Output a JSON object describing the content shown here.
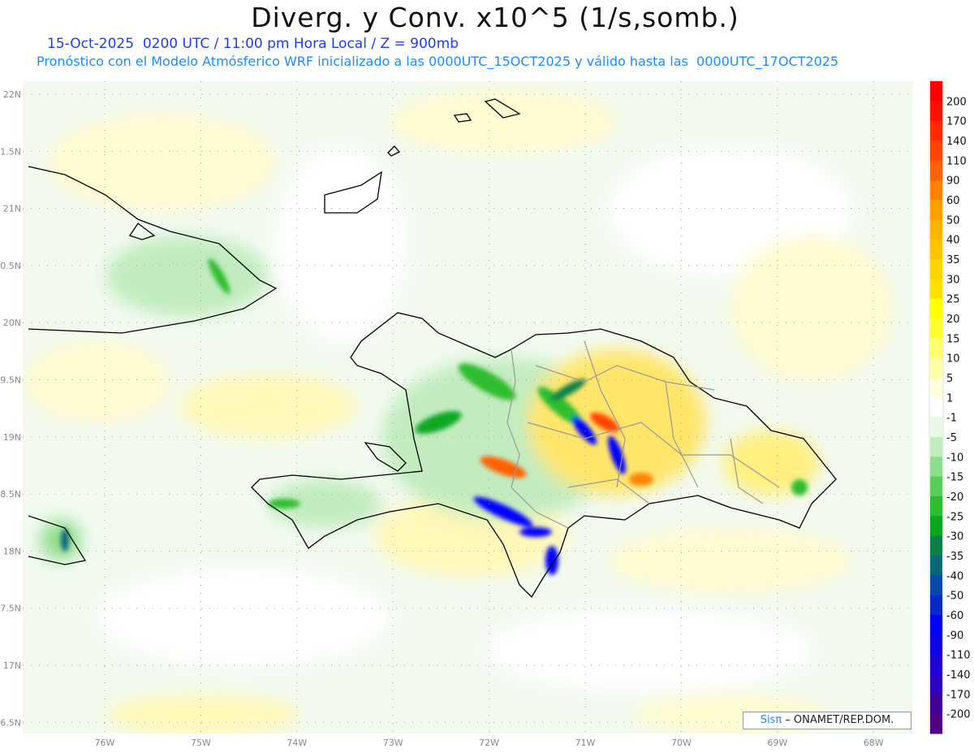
{
  "title": "Diverg. y Conv. x10^5 (1/s,somb.)",
  "subtitle_line1": "15-Oct-2025  0200 UTC / 11:00 pm Hora Local / Z = 900mb",
  "subtitle_line2": "Pronóstico con el Modelo Atmósferico WRF inicializado a las 0000UTC_15OCT2025 y válido hasta las  0000UTC_17OCT2025",
  "lat_labels": [
    "22N",
    "1.5N",
    "21N",
    "0.5N",
    "20N",
    "9.5N",
    "19N",
    "8.5N",
    "18N",
    "7.5N",
    "17N",
    "6.5N"
  ],
  "lon_labels": [
    "76W",
    "75W",
    "74W",
    "73W",
    "72W",
    "71W",
    "70W",
    "69W",
    "68W"
  ],
  "colorbar": {
    "labels": [
      "200",
      "170",
      "140",
      "110",
      "90",
      "60",
      "50",
      "40",
      "35",
      "30",
      "25",
      "20",
      "15",
      "10",
      "5",
      "1",
      "-1",
      "-5",
      "-10",
      "-15",
      "-20",
      "-25",
      "-30",
      "-35",
      "-40",
      "-50",
      "-60",
      "-90",
      "-110",
      "-140",
      "-170",
      "-200"
    ],
    "colors": [
      "#ff0000",
      "#ff1000",
      "#ff2a00",
      "#ff4400",
      "#ff6000",
      "#ff8200",
      "#ffa000",
      "#ffb400",
      "#ffc400",
      "#ffd400",
      "#ffe000",
      "#ffff00",
      "#ffff30",
      "#ffff70",
      "#ffffa8",
      "#ffffdc",
      "#ffffff",
      "#eaf8e8",
      "#c2ecc0",
      "#8fdd8c",
      "#5ccc5c",
      "#2ebd2e",
      "#08a820",
      "#08804a",
      "#086878",
      "#0848a8",
      "#0828c8",
      "#0000ff",
      "#1000e8",
      "#2000d8",
      "#3000c0",
      "#400098",
      "#500080"
    ]
  },
  "credit": {
    "brand": "Sisπ",
    "text": " – ONAMET/REP.DOM."
  }
}
